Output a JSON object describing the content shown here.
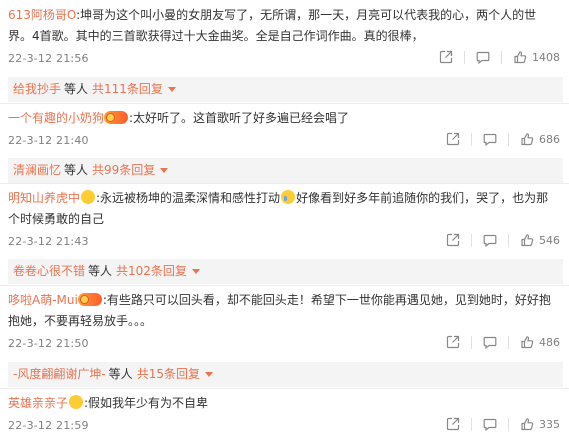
{
  "comments": [
    {
      "user": "613阿杨哥O",
      "text": ":坤哥为这个叫小曼的女朋友写了，无所谓，那一天，月亮可以代表我的心，两个人的世界。4首歌。其中的三首歌获得过十大金曲奖。全是自己作词作曲。真的很棒，",
      "time": "22-3-12 21:56",
      "likes": "1408",
      "reply": {
        "user": "给我抄手",
        "verb": "等人",
        "count": "共111条回复"
      }
    },
    {
      "user": "一个有趣的小奶狗",
      "badge": "铁粉",
      "text": ":太好听了。这首歌听了好多遍已经会唱了",
      "time": "22-3-12 21:40",
      "likes": "686",
      "reply": {
        "user": "清澜画忆",
        "verb": "等人",
        "count": "共99条回复"
      }
    },
    {
      "user": "明知山养虎中",
      "text": ":永远被杨坤的温柔深情和感性打动",
      "text2": "好像看到好多年前追随你的我们，哭了，也为那个时候勇敢的自己",
      "time": "22-3-12 21:43",
      "likes": "546",
      "reply": {
        "user": "卷卷心很不错",
        "verb": "等人",
        "count": "共102条回复"
      }
    },
    {
      "user": "哆啦A萌-Mui",
      "badge": "铁粉",
      "text": ":有些路只可以回头看，却不能回头走！希望下一世你能再遇见她，见到她时，好好抱抱她，不要再轻易放手。。。",
      "time": "22-3-12 21:50",
      "likes": "486",
      "reply": {
        "user": "-风度翩翩谢广坤-",
        "verb": "等人",
        "count": "共15条回复"
      }
    },
    {
      "user": "英雄亲亲子",
      "text": ":假如我年少有为不自卑",
      "time": "22-3-12 21:59",
      "likes": "335"
    }
  ],
  "icons": {
    "share": "share-icon",
    "comment": "comment-icon",
    "like": "thumbs-up-icon",
    "emoji": "emoji-icon",
    "badge": "fan-badge-icon"
  },
  "colors": {
    "username": "#eb7350",
    "text": "#333333",
    "meta": "#808080",
    "reply_bg": "#f4f4f4"
  }
}
